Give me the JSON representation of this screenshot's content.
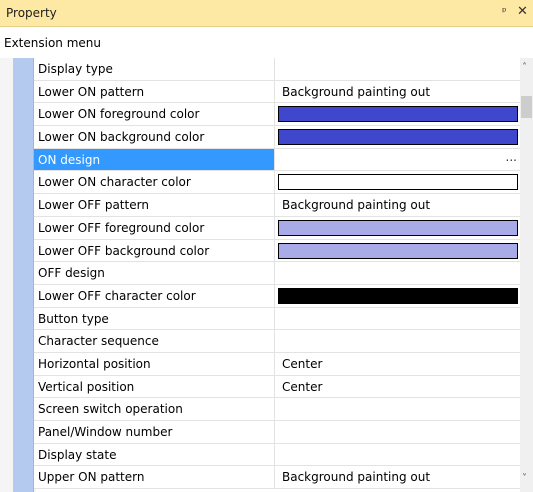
{
  "panel": {
    "title": "Property",
    "pin_glyph": "ᵨ",
    "close_glyph": "✕"
  },
  "category": "Extension menu",
  "colors": {
    "on_fg": "#3f48cc",
    "on_bg": "#3f48cc",
    "on_char": "#ffffff",
    "off_fg": "#a8abe8",
    "off_bg": "#a8abe8",
    "off_char": "#000000",
    "selection": "#3399ff",
    "strip": "#b4cbef"
  },
  "rows": [
    {
      "name": "Display type",
      "value": ""
    },
    {
      "name": "Lower ON pattern",
      "value": "Background painting out"
    },
    {
      "name": "Lower ON foreground color",
      "swatch": "#3f48cc"
    },
    {
      "name": "Lower ON background color",
      "swatch": "#3f48cc"
    },
    {
      "name": "ON design",
      "value": "",
      "selected": true,
      "ellipsis": "..."
    },
    {
      "name": "Lower ON character color",
      "swatch": "#ffffff"
    },
    {
      "name": "Lower OFF pattern",
      "value": "Background painting out"
    },
    {
      "name": "Lower OFF foreground color",
      "swatch": "#a8abe8"
    },
    {
      "name": "Lower OFF background color",
      "swatch": "#a8abe8"
    },
    {
      "name": "OFF design",
      "value": ""
    },
    {
      "name": "Lower OFF character color",
      "swatch": "#000000"
    },
    {
      "name": "Button type",
      "value": ""
    },
    {
      "name": "Character sequence",
      "value": ""
    },
    {
      "name": "Horizontal position",
      "value": "Center"
    },
    {
      "name": "Vertical position",
      "value": "Center"
    },
    {
      "name": "Screen switch operation",
      "value": ""
    },
    {
      "name": "Panel/Window number",
      "value": ""
    },
    {
      "name": "Display state",
      "value": ""
    },
    {
      "name": "Upper ON pattern",
      "value": "Background painting out"
    }
  ],
  "scrollbar": {
    "up_icon": "˄",
    "down_icon": "˅"
  }
}
